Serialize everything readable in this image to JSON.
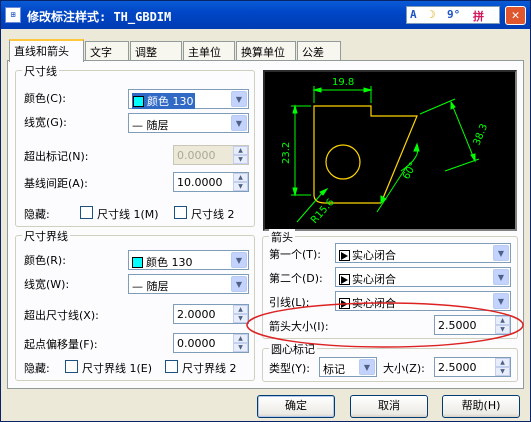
{
  "window": {
    "title": "修改标注样式: TH_GBDIM",
    "app_icon": "app-icon",
    "toolbar_glyphs": [
      "A",
      "☽",
      "9°",
      "拼"
    ],
    "close_glyph": "✕"
  },
  "tabs": [
    {
      "label": "直线和箭头",
      "active": true
    },
    {
      "label": "文字",
      "active": false
    },
    {
      "label": "调整",
      "active": false
    },
    {
      "label": "主单位",
      "active": false
    },
    {
      "label": "换算单位",
      "active": false
    },
    {
      "label": "公差",
      "active": false
    }
  ],
  "dim_line": {
    "title": "尺寸线",
    "color_label": "颜色(C):",
    "color_value": "颜色 130",
    "lineweight_label": "线宽(G):",
    "lineweight_value": "— 随层",
    "extend_label": "超出标记(N):",
    "extend_value": "0.0000",
    "baseline_label": "基线间距(A):",
    "baseline_value": "10.0000",
    "suppress_label": "隐藏:",
    "suppress1": "尺寸线 1(M)",
    "suppress2": "尺寸线 2"
  },
  "ext_line": {
    "title": "尺寸界线",
    "color_label": "颜色(R):",
    "color_value": "颜色 130",
    "lineweight_label": "线宽(W):",
    "lineweight_value": "— 随层",
    "extend_label": "超出尺寸线(X):",
    "extend_value": "2.0000",
    "offset_label": "起点偏移量(F):",
    "offset_value": "0.0000",
    "suppress_label": "隐藏:",
    "suppress1": "尺寸界线 1(E)",
    "suppress2": "尺寸界线 2"
  },
  "preview": {
    "dim_top": "19.8",
    "dim_left": "23.2",
    "dim_right": "38.3",
    "dim_angle": "60°",
    "dim_radius": "R15.6"
  },
  "arrows": {
    "title": "箭头",
    "first_label": "第一个(T):",
    "first_value": "实心闭合",
    "second_label": "第二个(D):",
    "second_value": "实心闭合",
    "leader_label": "引线(L):",
    "leader_value": "实心闭合",
    "size_label": "箭头大小(I):",
    "size_value": "2.5000"
  },
  "center": {
    "title": "圆心标记",
    "type_label": "类型(Y):",
    "type_value": "标记",
    "size_label": "大小(Z):",
    "size_value": "2.5000"
  },
  "buttons": {
    "ok": "确定",
    "cancel": "取消",
    "help": "帮助(H)"
  },
  "colors": {
    "title_bar": "#0046c6",
    "dialog_bg": "#ece9d8",
    "preview_bg": "#000000",
    "preview_dim": "#00ff00",
    "preview_geom": "#ffd700",
    "annotation_ellipse": "#dd2222"
  }
}
